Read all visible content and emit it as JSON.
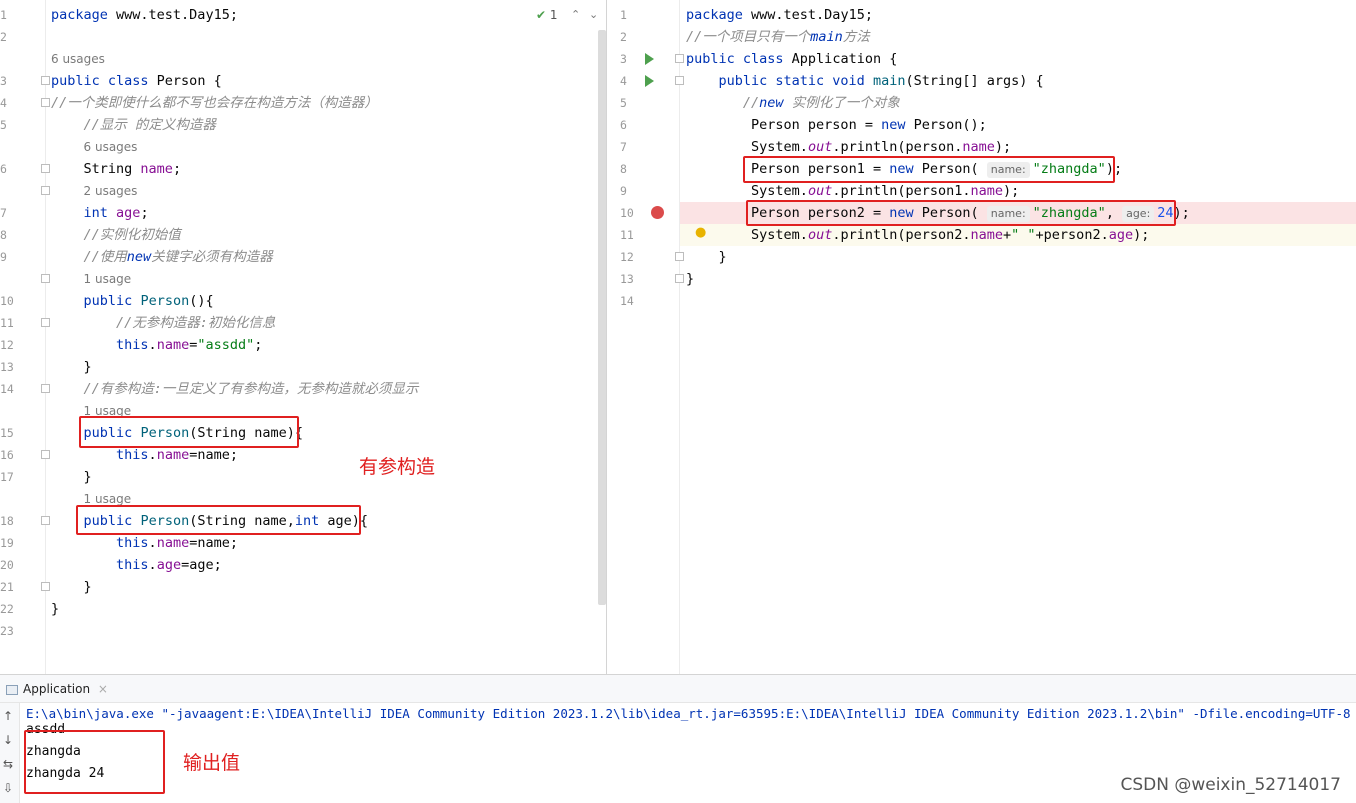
{
  "left_editor": {
    "indicator_count": "1",
    "lines": [
      {
        "n": "1",
        "tokens": [
          [
            "kw",
            "package"
          ],
          [
            "p",
            " www.test.Day15;"
          ]
        ]
      },
      {
        "n": "2",
        "tokens": []
      },
      {
        "n": "",
        "hint": "6 usages"
      },
      {
        "n": "3",
        "tokens": [
          [
            "kw",
            "public class"
          ],
          [
            "p",
            " Person {"
          ]
        ]
      },
      {
        "n": "4",
        "tokens": [
          [
            "cm",
            "//一个类即使什么都不写也会存在构造方法（构造器）"
          ]
        ]
      },
      {
        "n": "5",
        "tokens": [
          [
            "i",
            "    "
          ],
          [
            "cm",
            "//显示 的定义构造器"
          ]
        ]
      },
      {
        "n": "",
        "hint": "6 usages",
        "indent": "    "
      },
      {
        "n": "6",
        "tokens": [
          [
            "i",
            "    "
          ],
          [
            "p",
            "String "
          ],
          [
            "fld",
            "name"
          ],
          [
            "p",
            ";"
          ]
        ]
      },
      {
        "n": "",
        "hint": "2 usages",
        "indent": "    "
      },
      {
        "n": "7",
        "tokens": [
          [
            "i",
            "    "
          ],
          [
            "kw",
            "int"
          ],
          [
            "p",
            " "
          ],
          [
            "fld",
            "age"
          ],
          [
            "p",
            ";"
          ]
        ]
      },
      {
        "n": "8",
        "tokens": [
          [
            "i",
            "    "
          ],
          [
            "cm",
            "//实例化初始值"
          ]
        ]
      },
      {
        "n": "9",
        "tokens": [
          [
            "i",
            "    "
          ],
          [
            "cm",
            "//使用"
          ],
          [
            "cmk",
            "new"
          ],
          [
            "cm",
            "关键字必须有构造器"
          ]
        ]
      },
      {
        "n": "",
        "hint": "1 usage",
        "indent": "    "
      },
      {
        "n": "10",
        "tokens": [
          [
            "i",
            "    "
          ],
          [
            "kw",
            "public"
          ],
          [
            "p",
            " "
          ],
          [
            "mth",
            "Person"
          ],
          [
            "p",
            "(){"
          ]
        ]
      },
      {
        "n": "11",
        "tokens": [
          [
            "i",
            "        "
          ],
          [
            "cm",
            "//无参构造器:初始化信息"
          ]
        ]
      },
      {
        "n": "12",
        "tokens": [
          [
            "i",
            "        "
          ],
          [
            "kw",
            "this"
          ],
          [
            "p",
            "."
          ],
          [
            "fld",
            "name"
          ],
          [
            "p",
            "="
          ],
          [
            "str",
            "\"assdd\""
          ],
          [
            "p",
            ";"
          ]
        ]
      },
      {
        "n": "13",
        "tokens": [
          [
            "i",
            "    "
          ],
          [
            "p",
            "}"
          ]
        ]
      },
      {
        "n": "14",
        "tokens": [
          [
            "i",
            "    "
          ],
          [
            "cm",
            "//有参构造:一旦定义了有参构造，无参构造就必须显示"
          ]
        ]
      },
      {
        "n": "",
        "hint": "1 usage",
        "indent": "    "
      },
      {
        "n": "15",
        "tokens": [
          [
            "i",
            "    "
          ],
          [
            "kw",
            "public"
          ],
          [
            "p",
            " "
          ],
          [
            "mth",
            "Person"
          ],
          [
            "p",
            "(String name){"
          ]
        ]
      },
      {
        "n": "16",
        "tokens": [
          [
            "i",
            "        "
          ],
          [
            "kw",
            "this"
          ],
          [
            "p",
            "."
          ],
          [
            "fld",
            "name"
          ],
          [
            "p",
            "=name;"
          ]
        ]
      },
      {
        "n": "17",
        "tokens": [
          [
            "i",
            "    "
          ],
          [
            "p",
            "}"
          ]
        ]
      },
      {
        "n": "",
        "hint": "1 usage",
        "indent": "    "
      },
      {
        "n": "18",
        "tokens": [
          [
            "i",
            "    "
          ],
          [
            "kw",
            "public"
          ],
          [
            "p",
            " "
          ],
          [
            "mth",
            "Person"
          ],
          [
            "p",
            "(String name,"
          ],
          [
            "kw",
            "int"
          ],
          [
            "p",
            " age){"
          ]
        ]
      },
      {
        "n": "19",
        "tokens": [
          [
            "i",
            "        "
          ],
          [
            "kw",
            "this"
          ],
          [
            "p",
            "."
          ],
          [
            "fld",
            "name"
          ],
          [
            "p",
            "=name;"
          ]
        ]
      },
      {
        "n": "20",
        "tokens": [
          [
            "i",
            "        "
          ],
          [
            "kw",
            "this"
          ],
          [
            "p",
            "."
          ],
          [
            "fld",
            "age"
          ],
          [
            "p",
            "=age;"
          ]
        ]
      },
      {
        "n": "21",
        "tokens": [
          [
            "i",
            "    "
          ],
          [
            "p",
            "}"
          ]
        ]
      },
      {
        "n": "22",
        "tokens": [
          [
            "p",
            "}"
          ]
        ]
      },
      {
        "n": "23",
        "tokens": []
      }
    ],
    "annotation": "有参构造"
  },
  "right_editor": {
    "lines": [
      {
        "n": "1",
        "tokens": [
          [
            "kw",
            "package"
          ],
          [
            "p",
            " www.test.Day15;"
          ]
        ]
      },
      {
        "n": "2",
        "tokens": [
          [
            "cm",
            "//一个项目只有一个"
          ],
          [
            "cmk",
            "main"
          ],
          [
            "cm",
            "方法"
          ]
        ]
      },
      {
        "n": "3",
        "tokens": [
          [
            "kw",
            "public class"
          ],
          [
            "p",
            " Application {"
          ]
        ]
      },
      {
        "n": "4",
        "tokens": [
          [
            "i",
            "    "
          ],
          [
            "kw",
            "public static void"
          ],
          [
            "p",
            " "
          ],
          [
            "mth",
            "main"
          ],
          [
            "p",
            "(String[] args) {"
          ]
        ]
      },
      {
        "n": "5",
        "tokens": [
          [
            "i",
            "       "
          ],
          [
            "cm",
            "//"
          ],
          [
            "cmk",
            "new"
          ],
          [
            "cm",
            " 实例化了一个对象"
          ]
        ]
      },
      {
        "n": "6",
        "tokens": [
          [
            "i",
            "        "
          ],
          [
            "p",
            "Person person = "
          ],
          [
            "kw",
            "new"
          ],
          [
            "p",
            " Person();"
          ]
        ]
      },
      {
        "n": "7",
        "tokens": [
          [
            "i",
            "        "
          ],
          [
            "p",
            "System."
          ],
          [
            "st",
            "out"
          ],
          [
            "p",
            ".println(person."
          ],
          [
            "fld",
            "name"
          ],
          [
            "p",
            ");"
          ]
        ]
      },
      {
        "n": "8",
        "tokens": [
          [
            "i",
            "        "
          ],
          [
            "p",
            "Person person1 = "
          ],
          [
            "kw",
            "new"
          ],
          [
            "p",
            " Person( "
          ],
          [
            "h",
            "name:"
          ],
          [
            "str",
            "\"zhangda\""
          ],
          [
            "p",
            ");"
          ]
        ]
      },
      {
        "n": "9",
        "tokens": [
          [
            "i",
            "        "
          ],
          [
            "p",
            "System."
          ],
          [
            "st",
            "out"
          ],
          [
            "p",
            ".println(person1."
          ],
          [
            "fld",
            "name"
          ],
          [
            "p",
            ");"
          ]
        ]
      },
      {
        "n": "10",
        "tokens": [
          [
            "i",
            "        "
          ],
          [
            "p",
            "Person person2 = "
          ],
          [
            "kw",
            "new"
          ],
          [
            "p",
            " Person( "
          ],
          [
            "h",
            "name:"
          ],
          [
            "str",
            "\"zhangda\""
          ],
          [
            "p",
            ", "
          ],
          [
            "h",
            "age:"
          ],
          [
            "num",
            "24"
          ],
          [
            "p",
            ");"
          ]
        ]
      },
      {
        "n": "11",
        "tokens": [
          [
            "i",
            "        "
          ],
          [
            "p",
            "System."
          ],
          [
            "st",
            "out"
          ],
          [
            "p",
            ".println(person2."
          ],
          [
            "fld",
            "name"
          ],
          [
            "p",
            "+"
          ],
          [
            "str",
            "\" \""
          ],
          [
            "p",
            "+person2."
          ],
          [
            "fld",
            "age"
          ],
          [
            "p",
            ");"
          ]
        ]
      },
      {
        "n": "12",
        "tokens": [
          [
            "i",
            "    "
          ],
          [
            "p",
            "}"
          ]
        ]
      },
      {
        "n": "13",
        "tokens": [
          [
            "p",
            "}"
          ]
        ]
      },
      {
        "n": "14",
        "tokens": []
      }
    ]
  },
  "run_panel": {
    "tab_label": "Application",
    "close_glyph": "×",
    "command": "E:\\a\\bin\\java.exe \"-javaagent:E:\\IDEA\\IntelliJ IDEA Community Edition 2023.1.2\\lib\\idea_rt.jar=63595:E:\\IDEA\\IntelliJ IDEA Community Edition 2023.1.2\\bin\" -Dfile.encoding=UTF-8",
    "output": [
      "assdd",
      "zhangda",
      "zhangda 24"
    ],
    "annotation": "输出值",
    "tools": [
      "↑",
      "↓",
      "⇆",
      "⇩"
    ]
  },
  "watermark": "CSDN @weixin_52714017",
  "colors": {
    "accent_red": "#e02020",
    "keyword": "#0033b3",
    "string": "#067d17",
    "field": "#871094"
  }
}
